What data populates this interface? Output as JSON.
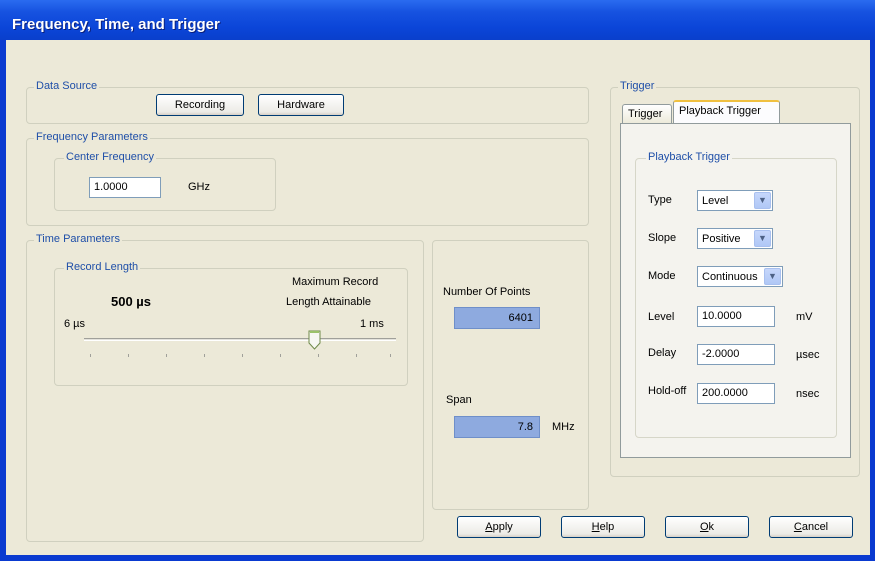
{
  "window": {
    "title": "Frequency, Time, and Trigger"
  },
  "data_source": {
    "label": "Data Source",
    "buttons": [
      "Recording",
      "Hardware"
    ]
  },
  "frequency": {
    "label": "Frequency Parameters",
    "center": {
      "label": "Center Frequency",
      "value": "1.0000",
      "unit": "GHz"
    }
  },
  "time": {
    "label": "Time Parameters",
    "record_length": {
      "label": "Record Length",
      "value": "500 µs",
      "max_label_line1": "Maximum Record",
      "max_label_line2": "Length Attainable",
      "min": "6 µs",
      "max": "1 ms",
      "slider_fraction": 0.75
    }
  },
  "readouts": {
    "points_label": "Number Of Points",
    "points_value": "6401",
    "span_label": "Span",
    "span_value": "7.8",
    "span_unit": "MHz"
  },
  "trigger": {
    "label": "Trigger",
    "tabs": [
      "Trigger",
      "Playback Trigger"
    ],
    "active_tab": "Playback Trigger",
    "playback": {
      "label": "Playback Trigger",
      "type_label": "Type",
      "type_value": "Level",
      "slope_label": "Slope",
      "slope_value": "Positive",
      "mode_label": "Mode",
      "mode_value": "Continuous",
      "level_label": "Level",
      "level_value": "10.0000",
      "level_unit": "mV",
      "delay_label": "Delay",
      "delay_value": "-2.0000",
      "delay_unit": "µsec",
      "holdoff_label": "Hold-off",
      "holdoff_value": "200.0000",
      "holdoff_unit": "nsec"
    }
  },
  "footer": {
    "apply": "Apply",
    "apply_key": "A",
    "help": "Help",
    "help_key": "H",
    "ok": "Ok",
    "ok_key": "O",
    "cancel": "Cancel",
    "cancel_key": "C"
  },
  "colors": {
    "title_bar": "#0b45d8",
    "dialog_bg": "#ece9d8",
    "group_label": "#1f4fa8",
    "readout_bg": "#8eaadf"
  },
  "icons": {
    "dropdown": "chevron-down-icon",
    "slider_thumb": "slider-thumb-icon"
  }
}
